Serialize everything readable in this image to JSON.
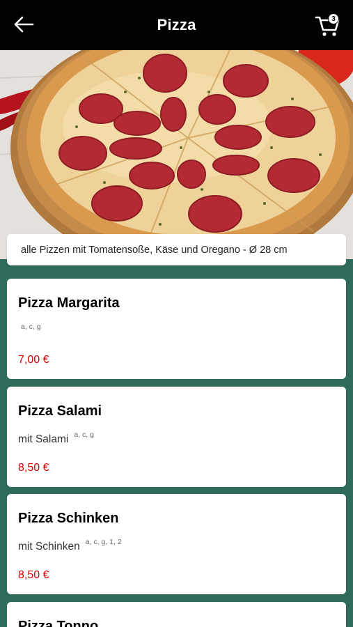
{
  "header": {
    "title": "Pizza",
    "back_icon": "arrow-left-icon",
    "cart_icon": "shopping-cart-icon",
    "cart_count": "3"
  },
  "hero": {
    "image": "pizza-salami-photo"
  },
  "info": {
    "text": "alle Pizzen mit Tomatensoße, Käse und Oregano - Ø 28 cm"
  },
  "items": [
    {
      "name": "Pizza Margarita",
      "description": "",
      "allergens": "a, c, g",
      "price": "7,00 €"
    },
    {
      "name": "Pizza Salami",
      "description": "mit Salami",
      "allergens": "a, c, g",
      "price": "8,50 €"
    },
    {
      "name": "Pizza Schinken",
      "description": "mit Schinken",
      "allergens": "a, c, g, 1, 2",
      "price": "8,50 €"
    },
    {
      "name": "Pizza Tonno",
      "description": "",
      "allergens": "",
      "price": ""
    }
  ],
  "colors": {
    "background": "#2e6b5a",
    "price": "#d40000",
    "header": "#000000"
  }
}
